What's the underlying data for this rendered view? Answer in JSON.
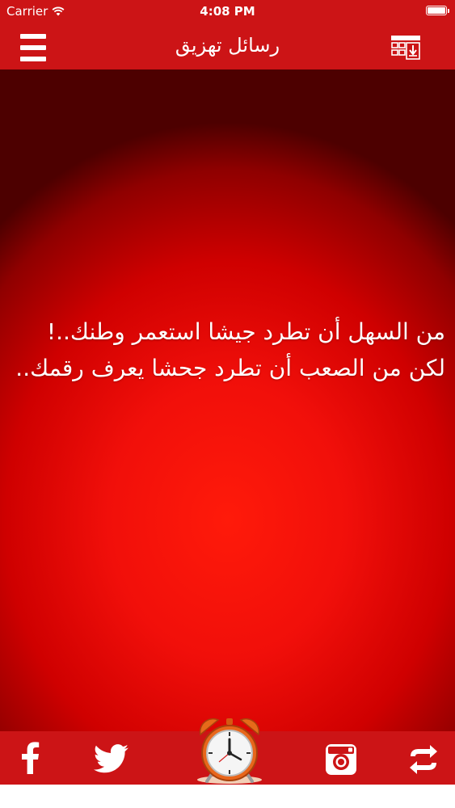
{
  "status_bar": {
    "carrier": "Carrier",
    "time": "4:08 PM",
    "wifi_icon": "wifi-icon",
    "battery_icon": "battery-icon",
    "battery_level": 1.0
  },
  "nav_bar": {
    "title": "رسائل تهزيق",
    "menu_icon": "hamburger-menu-icon",
    "download_icon": "grid-download-icon"
  },
  "message": {
    "lines": [
      "من السهل أن تطرد جيشا استعمر وطنك..!",
      "لكن من الصعب أن تطرد جحشا يعرف رقمك.."
    ]
  },
  "bottom_bar": {
    "icons": [
      "facebook-icon",
      "twitter-icon",
      "alarm-clock-icon",
      "instagram-icon",
      "refresh-arrows-icon"
    ]
  },
  "colors": {
    "bar": "#cc1416",
    "content_center": "#ff1a0a",
    "content_edge": "#4d0000",
    "text": "#ffffff"
  }
}
